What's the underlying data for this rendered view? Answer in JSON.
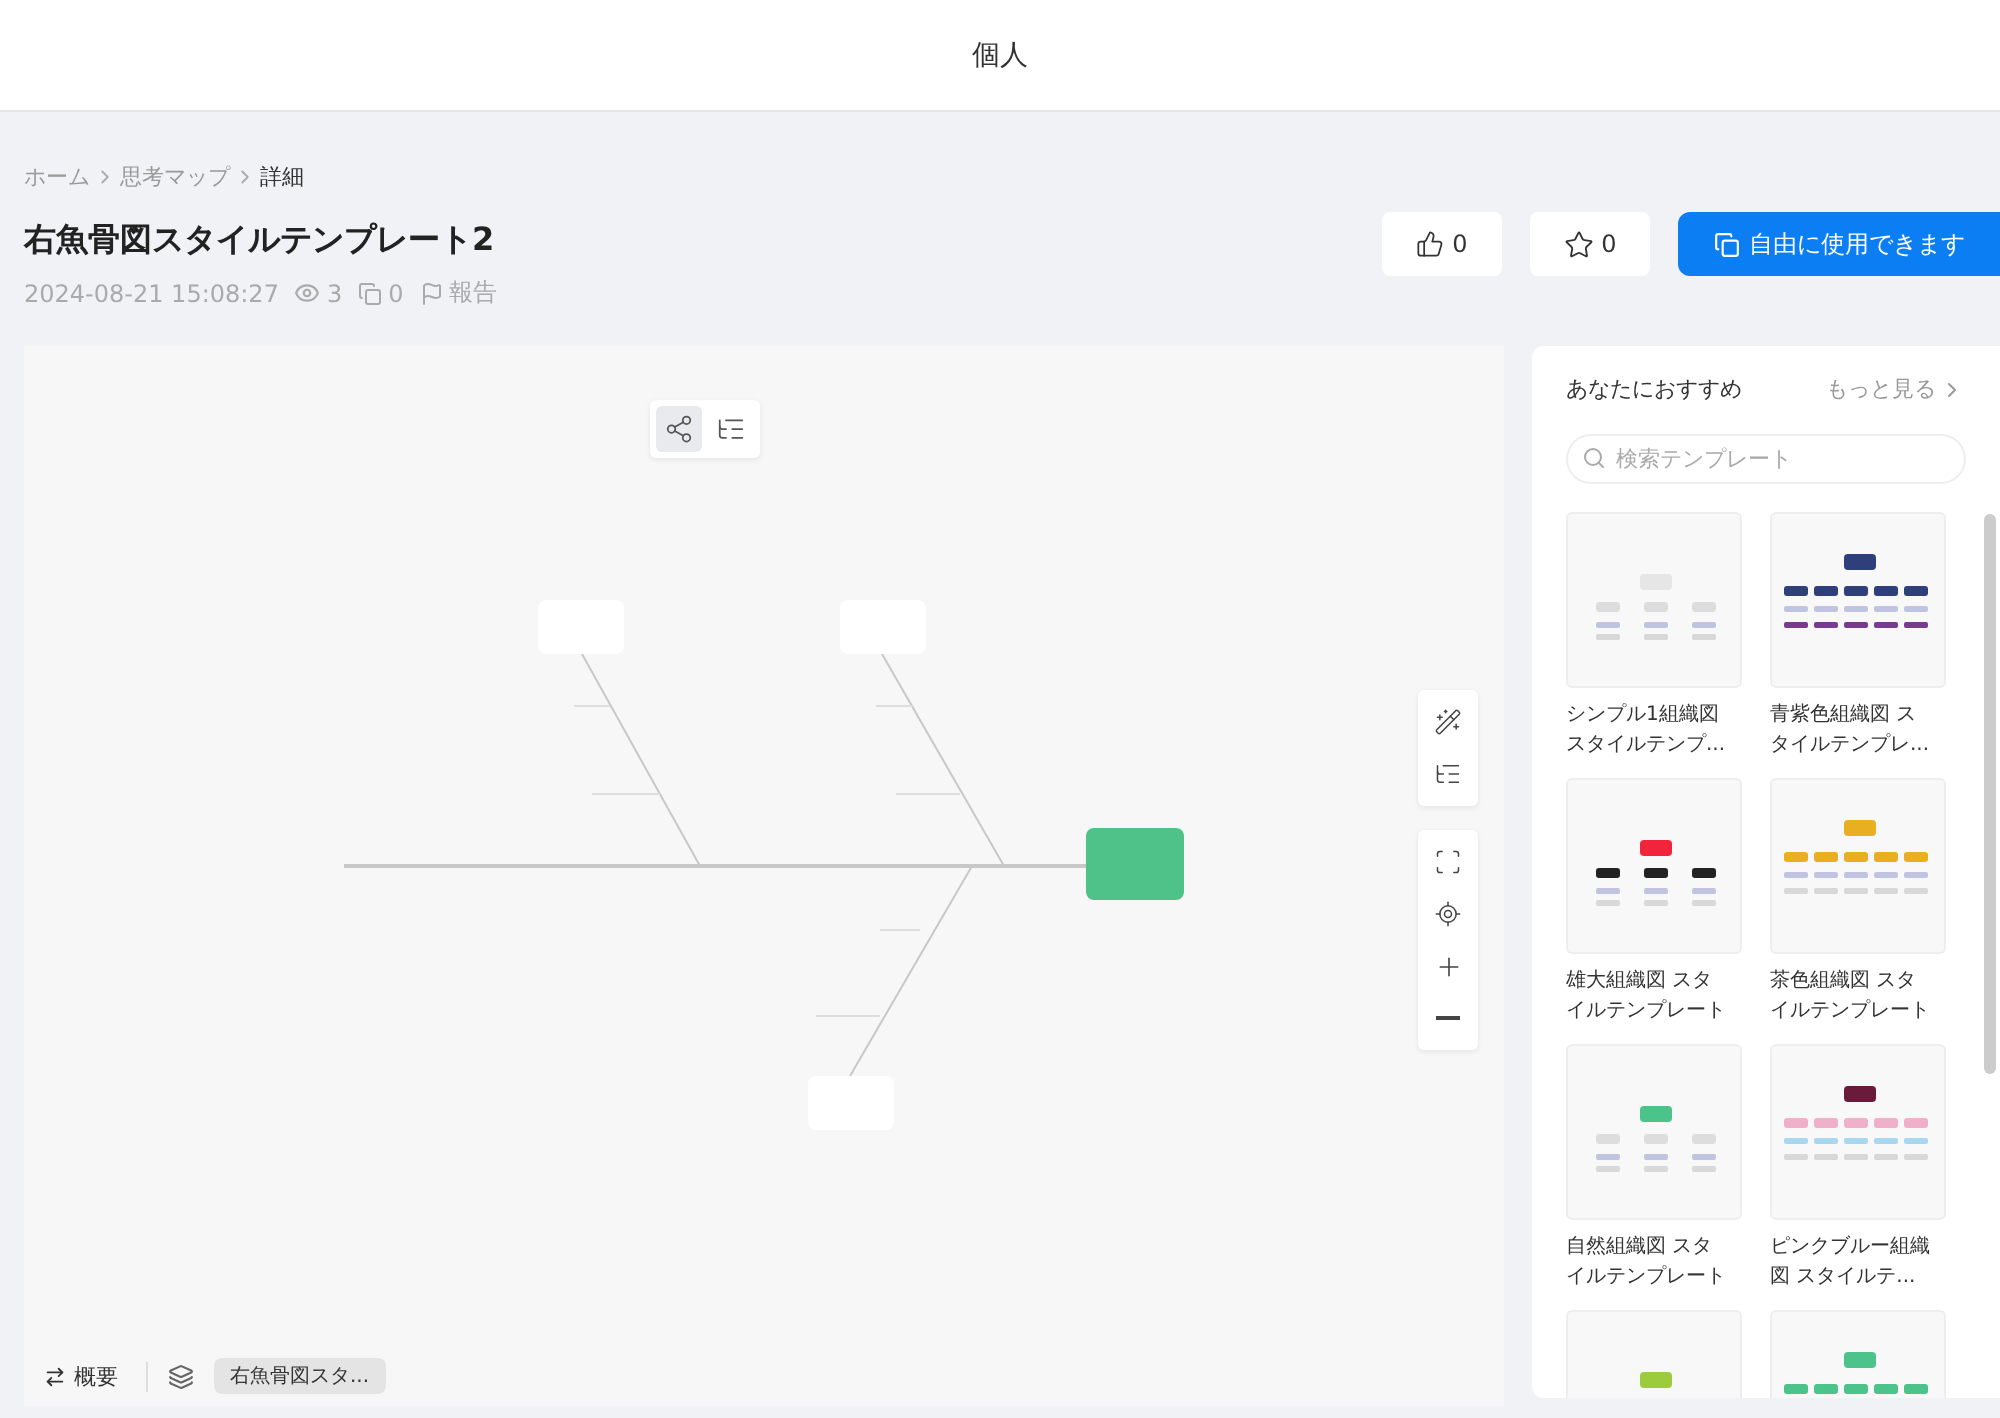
{
  "header": {
    "title": "個人"
  },
  "breadcrumb": [
    {
      "label": "ホーム",
      "selected": false
    },
    {
      "label": "思考マップ",
      "selected": false
    },
    {
      "label": "詳細",
      "selected": true
    }
  ],
  "title": "右魚骨図スタイルテンプレート2",
  "meta": {
    "date": "2024-08-21 15:08:27",
    "views": "3",
    "copies": "0",
    "report": "報告"
  },
  "actions": {
    "likes": "0",
    "stars": "0",
    "use": "自由に使用できます"
  },
  "canvas": {
    "views": [
      {
        "kind": "diagram",
        "selected": true
      },
      {
        "kind": "outline",
        "selected": false
      }
    ],
    "bottom_bar": {
      "outline": "概要",
      "page": "右魚骨図スタ..."
    }
  },
  "recommend": {
    "heading": "あなたにおすすめ",
    "more": "もっと見る",
    "search": {
      "placeholder": "検索テンプレート"
    },
    "cards": [
      {
        "title": "シンプル1組織図スタイルテンプ...",
        "color": "#e6e6e6"
      },
      {
        "title": "青紫色組織図 スタイルテンプレ...",
        "color": "#2e3f7c"
      },
      {
        "title": "雄大組織図 スタイルテンプレート",
        "color": "#f0253c"
      },
      {
        "title": "茶色組織図 スタイルテンプレート",
        "color": "#e8b020"
      },
      {
        "title": "自然組織図 スタイルテンプレート",
        "color": "#4cc38a"
      },
      {
        "title": "ピンクブルー組織図 スタイルテ...",
        "color": "#6a1a3a"
      },
      {
        "color": "#9ccc3c"
      },
      {
        "color": "#4cc38a"
      }
    ]
  }
}
